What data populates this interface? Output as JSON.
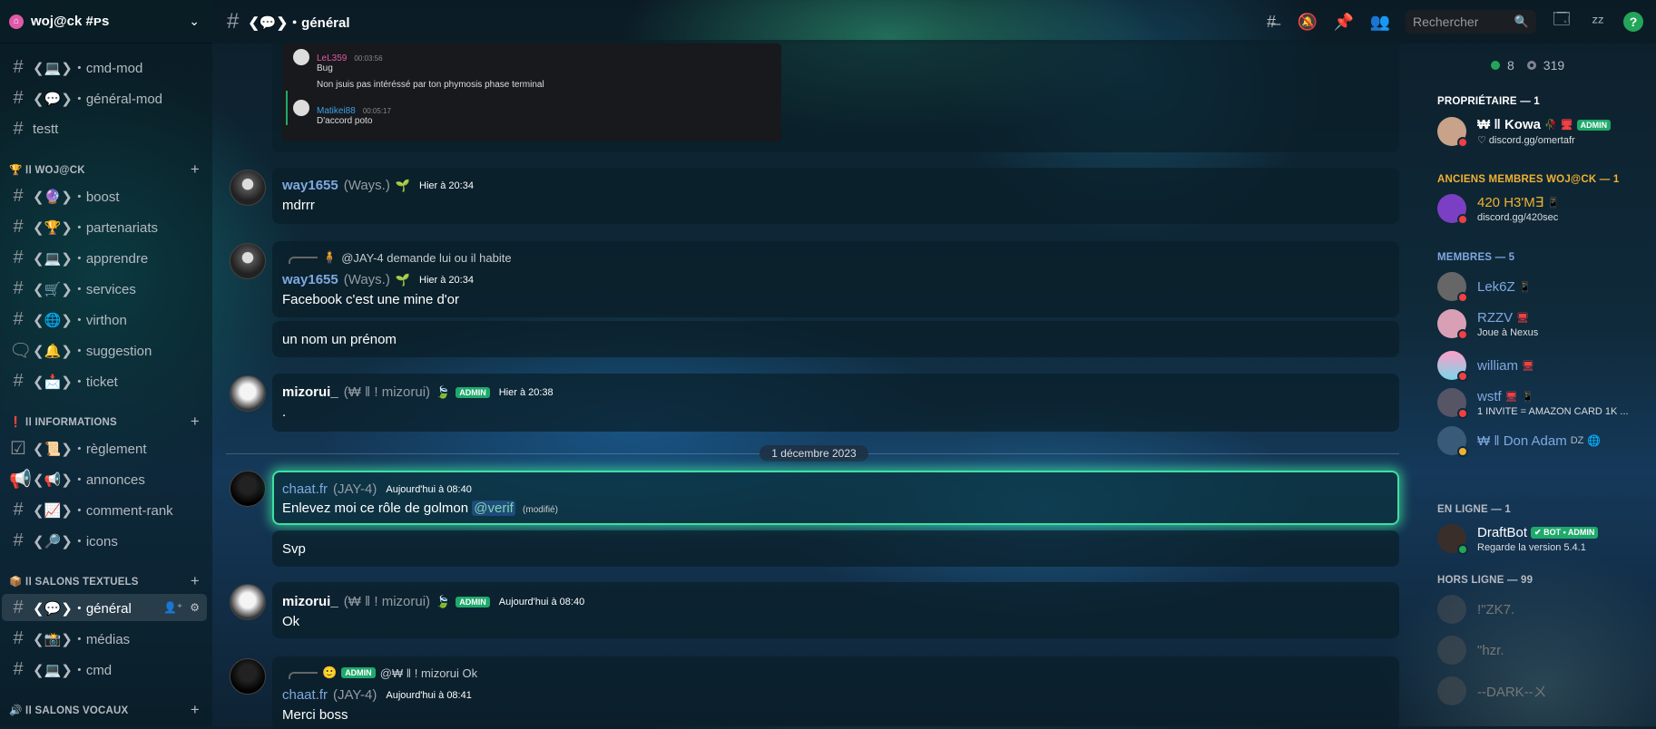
{
  "server": {
    "name": "woj@ck #ᴘs"
  },
  "sidebar": {
    "channels_top": [
      {
        "label": "❮💻❯・cmd-mod"
      },
      {
        "label": "❮💬❯・général-mod"
      },
      {
        "label": "testt"
      }
    ],
    "cat_wojack": "🏆 ꓲꓲ WOJ@CK",
    "channels_wojack": [
      {
        "label": "❮🔮❯・boost"
      },
      {
        "label": "❮🏆❯・partenariats"
      },
      {
        "label": "❮💻❯・apprendre"
      },
      {
        "label": "❮🛒❯・services"
      },
      {
        "label": "❮🌐❯・virthon"
      },
      {
        "label": "❮🔔❯・suggestion"
      },
      {
        "label": "❮📩❯・ticket"
      }
    ],
    "cat_info": "❗ ꓲꓲ INFORMATIONS",
    "channels_info": [
      {
        "label": "❮📜❯・règlement"
      },
      {
        "label": "❮📢❯・annonces"
      },
      {
        "label": "❮📈❯・comment-rank"
      },
      {
        "label": "❮🔎❯・icons"
      }
    ],
    "cat_textuels": "📦 ꓲꓲ SALONS TEXTUELS",
    "channels_textuels": [
      {
        "label": "❮💬❯・général"
      },
      {
        "label": "❮📸❯・médias"
      },
      {
        "label": "❮💻❯・cmd"
      }
    ],
    "cat_vocaux": "🔊 ꓲꓲ SALONS VOCAUX"
  },
  "topbar": {
    "channel_title": "❮💬❯・général",
    "search_placeholder": "Rechercher"
  },
  "embed": {
    "m1": {
      "user": "LeL359",
      "time": "00:03:56",
      "line1": "Bug",
      "line2": "Non jsuis pas intéréssé par ton phymosis phase terminal"
    },
    "m2": {
      "user": "Matikei88",
      "time": "00:05:17",
      "line1": "D'accord poto"
    }
  },
  "messages": [
    {
      "user": "way1655",
      "nick": "(Ways.)",
      "time": "Hier à 20:34",
      "text": "mdrrr"
    },
    {
      "reply": "@JAY-4 demande lui ou il habite",
      "user": "way1655",
      "nick": "(Ways.)",
      "time": "Hier à 20:34",
      "text": "Facebook c'est une mine d'or",
      "followup": "un nom un prénom"
    },
    {
      "user": "mizorui_",
      "nick": "(₩ ǁ ! mizorui)",
      "badge": "ADMIN",
      "time": "Hier à 20:38",
      "text": "."
    },
    {
      "user": "chaat.fr",
      "nick": "(JAY-4)",
      "time": "Aujourd'hui à 08:40",
      "text": "Enlevez moi ce rôle de golmon",
      "mention": "@verif",
      "edited": "(modifié)",
      "followup": "Svp"
    },
    {
      "user": "mizorui_",
      "nick": "(₩ ǁ ! mizorui)",
      "badge": "ADMIN",
      "time": "Aujourd'hui à 08:40",
      "text": "Ok"
    },
    {
      "reply_badge": "ADMIN",
      "reply": "@₩ ǁ ! mizorui Ok",
      "user": "chaat.fr",
      "nick": "(JAY-4)",
      "time": "Aujourd'hui à 08:41",
      "text": "Merci boss"
    }
  ],
  "divider_date": "1 décembre 2023",
  "members": {
    "online_count": "8",
    "total_count": "319",
    "cat_owner": "PROPRIÉTAIRE — 1",
    "cat_former": "ANCIENS MEMBRES WOJ@CK — 1",
    "cat_members": "MEMBRES — 5",
    "cat_online": "EN LIGNE — 1",
    "cat_offline": "HORS LIGNE — 99",
    "owner": {
      "name": "₩ ǁ Kowa",
      "badge": "ADMIN",
      "sub": "discord.gg/omertafr"
    },
    "former": {
      "name": "420 H3'M∃",
      "sub": "discord.gg/420sec"
    },
    "list": [
      {
        "name": "Lek6Z",
        "sub": ""
      },
      {
        "name": "RZZV",
        "sub": "Joue à Nexus"
      },
      {
        "name": "william",
        "sub": ""
      },
      {
        "name": "wstf",
        "sub": "1 INVITE = AMAZON CARD 1K ..."
      },
      {
        "name": "₩ ǁ Don Adam",
        "tag": "DZ",
        "sub": ""
      }
    ],
    "online_bot": {
      "name": "DraftBot",
      "badge": "✔ BOT • ADMIN",
      "sub": "Regarde la version 5.4.1"
    },
    "offline": [
      {
        "name": "!\"ZK7."
      },
      {
        "name": "\"hzr."
      },
      {
        "name": "--DARK--ㄨ"
      }
    ]
  },
  "colors": {
    "accent": "#1faa6b",
    "link": "#7fa8e0",
    "gold": "#f0b132",
    "dnd": "#f23f43",
    "online": "#23a55a"
  }
}
